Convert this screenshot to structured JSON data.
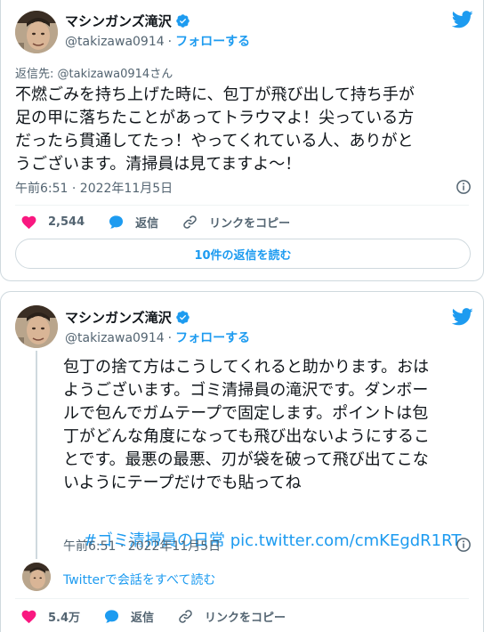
{
  "colors": {
    "accent": "#1d9bf0",
    "like": "#f91880",
    "text": "#0f1419",
    "muted": "#536471",
    "border": "#cfd9de"
  },
  "tweet1": {
    "author": {
      "display_name": "マシンガンズ滝沢",
      "handle": "@takizawa0914",
      "separator": "·",
      "follow_label": "フォローする",
      "verified_icon": "verified-badge-icon"
    },
    "reply_to_prefix": "返信先: ",
    "reply_to_handle": "@takizawa0914さん",
    "text": "不燃ごみを持ち上げた時に、包丁が飛び出して持ち手が\n足の甲に落ちたことがあってトラウマよ！尖っている方\nだったら貫通してたっ！やってくれている人、ありがと\nうございます。清掃員は見てますよ～！",
    "timestamp": "午前6:51 · 2022年11月5日",
    "likes": "2,544",
    "reply_label": "返信",
    "copy_link_label": "リンクをコピー",
    "read_replies_label": "10件の返信を読む"
  },
  "tweet2": {
    "author": {
      "display_name": "マシンガンズ滝沢",
      "handle": "@takizawa0914",
      "separator": "·",
      "follow_label": "フォローする",
      "verified_icon": "verified-badge-icon"
    },
    "text": "包丁の捨て方はこうしてくれると助かります。おは\nようございます。ゴミ清掃員の滝沢です。ダンボー\nルで包んでガムテープで固定します。ポイントは包\n丁がどんな角度になっても飛び出ないようにするこ\nとです。最悪の最悪、刃が袋を破って飛び出てこな\nいようにテープだけでも貼ってね",
    "hashtag": "#ゴミ清掃員の日常",
    "link": "pic.twitter.com/cmKEgdR1RT",
    "timestamp": "午前6:51 · 2022年11月5日",
    "read_conversation_label": "Twitterで会話をすべて読む",
    "likes": "5.4万",
    "reply_label": "返信",
    "copy_link_label": "リンクをコピー"
  }
}
